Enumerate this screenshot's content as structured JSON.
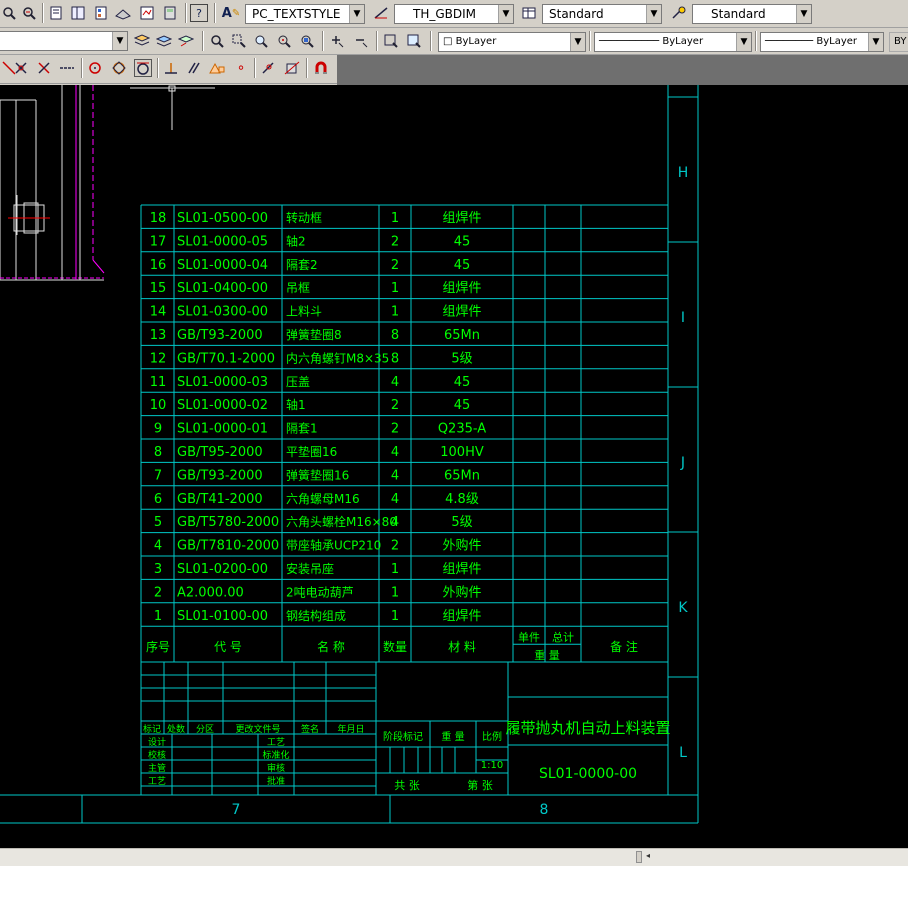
{
  "toolbar1": {
    "text_style_combo": "PC_TEXTSTYLE",
    "dim_style_combo": "TH_GBDIM",
    "table_style_combo": "Standard",
    "multileader_style_combo": "Standard"
  },
  "toolbar2": {
    "color_combo": "ByLayer",
    "linetype_combo": "ByLayer",
    "lineweight_combo": "ByLayer",
    "plotstyle_combo": "BY"
  },
  "icons": {
    "toolbar1": [
      "zoom-window-icon",
      "zoom-realtime-icon",
      "properties-icon",
      "design-center-icon",
      "tool-palettes-icon",
      "sheet-set-icon",
      "markup-icon",
      "quickcalc-icon",
      "help-icon",
      "text-style-icon",
      "dim-style-icon",
      "table-style-icon"
    ],
    "toolbar2": [
      "layer-properties-icon",
      "layer-state-icon",
      "layer-previous-icon",
      "zoom-window-icon",
      "zoom-dynamic-icon",
      "zoom-scale-icon",
      "zoom-center-icon",
      "zoom-object-icon",
      "zoom-in-icon",
      "zoom-out-icon",
      "zoom-all-icon",
      "zoom-extents-icon"
    ],
    "toolbar3": [
      "perpendicular-snap-icon",
      "intersection-snap-icon",
      "none-snap-icon",
      "center-snap-icon",
      "quadrant-snap-icon",
      "tangent-snap-icon",
      "perpendicular-icon",
      "parallel-icon",
      "insert-snap-icon",
      "node-snap-icon",
      "nearest-snap-icon",
      "object-snap-settings-icon",
      "magnet-icon"
    ]
  },
  "colors": {
    "canvas_bg": "#000000",
    "frame_lines": "#00c8c8",
    "table_text": "#00ff00",
    "magenta_lines": "#ff00ff",
    "toolbar_bg": "#d4d0c8"
  },
  "drawing": {
    "zone_letters": [
      "H",
      "I",
      "J",
      "K",
      "L"
    ],
    "zone_numbers": [
      "7",
      "8"
    ],
    "bom_rows": [
      {
        "no": "18",
        "code": "SL01-0500-00",
        "name": "转动框",
        "qty": "1",
        "material": "组焊件"
      },
      {
        "no": "17",
        "code": "SL01-0000-05",
        "name": "轴2",
        "qty": "2",
        "material": "45"
      },
      {
        "no": "16",
        "code": "SL01-0000-04",
        "name": "隔套2",
        "qty": "2",
        "material": "45"
      },
      {
        "no": "15",
        "code": "SL01-0400-00",
        "name": "吊框",
        "qty": "1",
        "material": "组焊件"
      },
      {
        "no": "14",
        "code": "SL01-0300-00",
        "name": "上料斗",
        "qty": "1",
        "material": "组焊件"
      },
      {
        "no": "13",
        "code": "GB/T93-2000",
        "name": "弹簧垫圈8",
        "qty": "8",
        "material": "65Mn"
      },
      {
        "no": "12",
        "code": "GB/T70.1-2000",
        "name": "内六角螺钉M8×35",
        "qty": "8",
        "material": "5级"
      },
      {
        "no": "11",
        "code": "SL01-0000-03",
        "name": "压盖",
        "qty": "4",
        "material": "45"
      },
      {
        "no": "10",
        "code": "SL01-0000-02",
        "name": "轴1",
        "qty": "2",
        "material": "45"
      },
      {
        "no": "9",
        "code": "SL01-0000-01",
        "name": "隔套1",
        "qty": "2",
        "material": "Q235-A"
      },
      {
        "no": "8",
        "code": "GB/T95-2000",
        "name": "平垫圈16",
        "qty": "4",
        "material": "100HV"
      },
      {
        "no": "7",
        "code": "GB/T93-2000",
        "name": "弹簧垫圈16",
        "qty": "4",
        "material": "65Mn"
      },
      {
        "no": "6",
        "code": "GB/T41-2000",
        "name": "六角螺母M16",
        "qty": "4",
        "material": "4.8级"
      },
      {
        "no": "5",
        "code": "GB/T5780-2000",
        "name": "六角头螺栓M16×80",
        "qty": "4",
        "material": "5级"
      },
      {
        "no": "4",
        "code": "GB/T7810-2000",
        "name": "带座轴承UCP210",
        "qty": "2",
        "material": "外购件"
      },
      {
        "no": "3",
        "code": "SL01-0200-00",
        "name": "安装吊座",
        "qty": "1",
        "material": "组焊件"
      },
      {
        "no": "2",
        "code": "A2.000.00",
        "name": "2吨电动葫芦",
        "qty": "1",
        "material": "外购件"
      },
      {
        "no": "1",
        "code": "SL01-0100-00",
        "name": "钢结构组成",
        "qty": "1",
        "material": "组焊件"
      }
    ],
    "bom_header": {
      "no": "序号",
      "code": "代  号",
      "name": "名  称",
      "qty": "数量",
      "material": "材  料",
      "unit": "单件",
      "total": "总计",
      "weight": "重  量",
      "remarks": "备  注"
    },
    "title_block": {
      "title": "履带抛丸机自动上料装置",
      "drawing_no": "SL01-0000-00",
      "scale": "1:10",
      "stage_mark": "阶段标记",
      "weight": "重  量",
      "ratio": "比例",
      "total_sheets": "共  张",
      "sheet_no": "第  张",
      "rev_headers": [
        "标记",
        "处数",
        "分区",
        "更改文件号",
        "签名",
        "年月日"
      ],
      "left_roles": [
        "设计",
        "校核",
        "主管",
        "工艺"
      ],
      "mid_roles": [
        "工艺",
        "标准化",
        "审核",
        "批准"
      ]
    }
  }
}
